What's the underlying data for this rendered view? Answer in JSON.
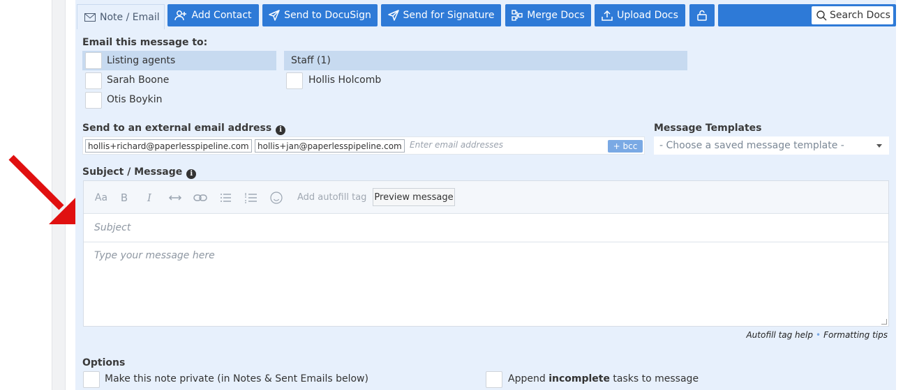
{
  "toolbar": {
    "note_tab": "Note / Email",
    "buttons": [
      {
        "label": "Add Contact",
        "icon": "add-user-icon"
      },
      {
        "label": "Send to DocuSign",
        "icon": "send-icon"
      },
      {
        "label": "Send for Signature",
        "icon": "send-icon"
      },
      {
        "label": "Merge Docs",
        "icon": "merge-icon"
      },
      {
        "label": "Upload Docs",
        "icon": "upload-icon"
      }
    ],
    "lock_icon": "lock-icon",
    "search_label": "Search Docs"
  },
  "recipients": {
    "heading": "Email this message to:",
    "groups": [
      {
        "label": "Listing agents",
        "members": [
          "Sarah Boone",
          "Otis Boykin"
        ]
      },
      {
        "label": "Staff (1)",
        "members": [
          "Hollis Holcomb"
        ]
      }
    ]
  },
  "external": {
    "label": "Send to an external email address",
    "chips": [
      "hollis+richard@paperlesspipeline.com",
      "hollis+jan@paperlesspipeline.com"
    ],
    "placeholder": "Enter email addresses",
    "bcc_label": "+ bcc"
  },
  "templates": {
    "label": "Message Templates",
    "selected": "- Choose a saved message template -"
  },
  "message": {
    "label": "Subject / Message",
    "toolbar_icons": [
      "font-size-icon",
      "bold-icon",
      "italic-icon",
      "horizontal-rule-icon",
      "link-icon",
      "bulleted-list-icon",
      "numbered-list-icon",
      "emoji-icon"
    ],
    "autofill_label": "Add autofill tag",
    "preview_label": "Preview message",
    "subject_placeholder": "Subject",
    "body_placeholder": "Type your message here"
  },
  "help": {
    "autofill_help": "Autofill tag help",
    "formatting_tips": "Formatting tips"
  },
  "options": {
    "heading": "Options",
    "private_label": "Make this note private (in Notes & Sent Emails below)",
    "append_prefix": "Append ",
    "append_bold": "incomplete",
    "append_suffix": " tasks to message"
  },
  "colors": {
    "accent": "#2e7ad7",
    "panel": "#e7f0fc",
    "arrow": "#e01010"
  }
}
